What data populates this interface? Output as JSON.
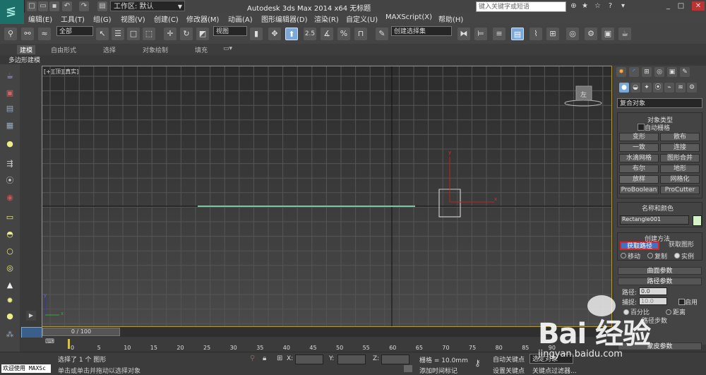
{
  "titlebar": {
    "workspace": "工作区: 默认",
    "title": "Autodesk 3ds Max  2014 x64      无标题",
    "search_placeholder": "键入关键字或短语"
  },
  "menubar": {
    "items": [
      "编辑(E)",
      "工具(T)",
      "组(G)",
      "视图(V)",
      "创建(C)",
      "修改器(M)",
      "动画(A)",
      "图形编辑器(D)",
      "渲染(R)",
      "自定义(U)",
      "MAXScript(X)",
      "帮助(H)"
    ]
  },
  "toolbar": {
    "filter": "全部",
    "refcoord": "视图",
    "snap_label": "2.5",
    "named_selection": "创建选择集",
    "accent": "#7aa8d8"
  },
  "ribbon": {
    "tabs": [
      "建模",
      "自由形式",
      "选择",
      "对象绘制",
      "填充"
    ],
    "poly_label": "多边形建模"
  },
  "viewport": {
    "label": "[+][顶][真实]",
    "viewcube_label": "左",
    "gizmo_x": "x",
    "gizmo_y": "y",
    "axis_x": "x",
    "axis_y": "y"
  },
  "command_panel": {
    "category": "复合对象",
    "object_type": {
      "header": "对象类型",
      "autogrid": "自动栅格",
      "buttons": [
        [
          "变形",
          "散布"
        ],
        [
          "一致",
          "连接"
        ],
        [
          "水滴网格",
          "图形合并"
        ],
        [
          "布尔",
          "地形"
        ],
        [
          "放样",
          "网格化"
        ],
        [
          "ProBoolean",
          "ProCutter"
        ]
      ]
    },
    "name_color": {
      "header": "名称和颜色",
      "name": "Rectangle001",
      "color": "#d6f2c9"
    },
    "creation_method": {
      "header": "创建方法",
      "get_path": "获取路径",
      "get_shape": "获取图形",
      "radio": [
        "移动",
        "复制",
        "实例"
      ]
    },
    "surface_params": {
      "header": "曲面参数"
    },
    "path_params": {
      "header": "路径参数",
      "path_label": "路径:",
      "path_value": "0.0",
      "snap_label": "捕捉:",
      "snap_value": "10.0",
      "enable": "启用",
      "percent": "百分比",
      "distance": "距离",
      "steps": "路径步数"
    },
    "skin_params": {
      "header": "蒙皮参数"
    }
  },
  "timeslider": {
    "frame": "0 / 100"
  },
  "trackbar": {
    "ticks": [
      "0",
      "5",
      "10",
      "15",
      "20",
      "25",
      "30",
      "35",
      "40",
      "45",
      "50",
      "55",
      "60",
      "65",
      "70",
      "75",
      "80",
      "85",
      "90"
    ]
  },
  "status": {
    "maxscript": "欢迎使用  MAXSc",
    "selected": "选择了 1 个 图形",
    "prompt": "单击或单击并拖动以选择对象",
    "x_label": "X:",
    "y_label": "Y:",
    "z_label": "Z:",
    "grid": "栅格 = 10.0mm",
    "add_tag": "添加时间标记",
    "autokey": "自动关键点",
    "set_key": "设置关键点",
    "selection_filter": "选定对象",
    "key_filter": "关键点过滤器..."
  },
  "watermark": {
    "text": "Bai 经验",
    "url": "jingyan.baidu.com"
  }
}
